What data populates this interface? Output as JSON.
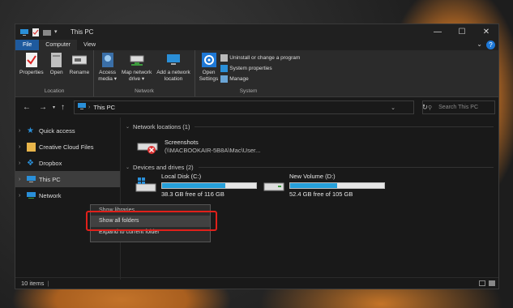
{
  "window": {
    "title": "This PC",
    "controls": {
      "minimize": "—",
      "maximize": "☐",
      "close": "✕"
    }
  },
  "tabs": [
    "File",
    "Computer",
    "View"
  ],
  "ribbon": {
    "location": {
      "label": "Location",
      "buttons": [
        {
          "label": "Properties",
          "icon": "properties-icon"
        },
        {
          "label": "Open",
          "icon": "open-icon"
        },
        {
          "label": "Rename",
          "icon": "rename-icon"
        }
      ]
    },
    "network": {
      "label": "Network",
      "buttons": [
        {
          "label": "Access\nmedia ▾",
          "icon": "access-media-icon"
        },
        {
          "label": "Map network\ndrive ▾",
          "icon": "map-network-drive-icon"
        },
        {
          "label": "Add a network\nlocation",
          "icon": "add-network-location-icon"
        }
      ]
    },
    "system": {
      "label": "System",
      "open_settings": "Open\nSettings",
      "items": [
        "Uninstall or change a program",
        "System properties",
        "Manage"
      ]
    }
  },
  "address": {
    "path": "This PC",
    "search_placeholder": "Search This PC"
  },
  "sidebar": [
    {
      "label": "Quick access",
      "icon": "star-icon"
    },
    {
      "label": "Creative Cloud Files",
      "icon": "creative-cloud-icon"
    },
    {
      "label": "Dropbox",
      "icon": "dropbox-icon"
    },
    {
      "label": "This PC",
      "icon": "computer-icon",
      "selected": true
    },
    {
      "label": "Network",
      "icon": "network-icon"
    }
  ],
  "main": {
    "network_section": "Network locations (1)",
    "network_location": {
      "name": "Screenshots",
      "path": "(\\\\MACBOOKAIR-5B8A\\Mac\\User..."
    },
    "drives_section": "Devices and drives (2)",
    "drives": [
      {
        "name": "Local Disk (C:)",
        "free": "38.3 GB free of 116 GB",
        "used_fraction": 0.67
      },
      {
        "name": "New Volume (D:)",
        "free": "52.4 GB free of 105 GB",
        "used_fraction": 0.5
      }
    ]
  },
  "context_menu": [
    "Show libraries",
    "Show all folders",
    "Expand to current folder"
  ],
  "status": {
    "items": "10 items"
  },
  "colors": {
    "accent": "#1e5a9e",
    "highlight_box": "#e0201a",
    "drive_bar": "#26a0da"
  }
}
